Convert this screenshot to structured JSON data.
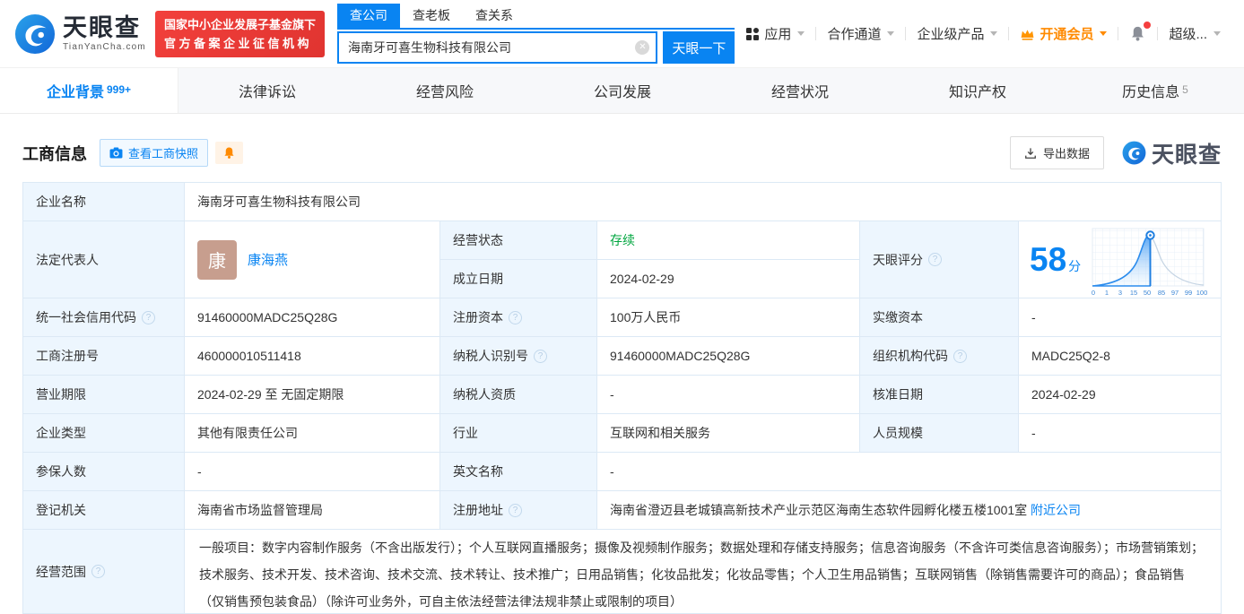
{
  "colors": {
    "brand_blue": "#0984f2",
    "badge_red": "#ee3c38",
    "vip_orange": "#ff8a00",
    "status_green": "#00a63f",
    "label_cell_bg": "#edf6fe"
  },
  "header": {
    "logo": {
      "name": "天眼查",
      "domain": "TianYanCha.com"
    },
    "badge": {
      "line1": "国家中小企业发展子基金旗下",
      "line2": "官方备案企业征信机构"
    },
    "search": {
      "tabs": [
        {
          "label": "查公司"
        },
        {
          "label": "查老板"
        },
        {
          "label": "查关系"
        }
      ],
      "value": "海南牙可喜生物科技有限公司",
      "button": "天眼一下"
    },
    "nav": [
      {
        "label": "应用"
      },
      {
        "label": "合作通道"
      },
      {
        "label": "企业级产品"
      },
      {
        "label": "开通会员"
      },
      {
        "label": "超级..."
      }
    ]
  },
  "tabs": [
    {
      "label": "企业背景",
      "badge": "999+"
    },
    {
      "label": "法律诉讼"
    },
    {
      "label": "经营风险"
    },
    {
      "label": "公司发展"
    },
    {
      "label": "经营状况"
    },
    {
      "label": "知识产权"
    },
    {
      "label": "历史信息",
      "badge": "5"
    }
  ],
  "section": {
    "title": "工商信息",
    "snapshot_button": "查看工商快照",
    "export_button": "导出数据",
    "logo_text": "天眼查"
  },
  "table": {
    "company_name": {
      "label": "企业名称",
      "value": "海南牙可喜生物科技有限公司"
    },
    "legal_rep": {
      "label": "法定代表人",
      "avatar": "康",
      "name": "康海燕"
    },
    "status": {
      "label": "经营状态",
      "value": "存续"
    },
    "established": {
      "label": "成立日期",
      "value": "2024-02-29"
    },
    "score": {
      "label": "天眼评分",
      "value": "58",
      "unit": "分"
    },
    "credit_code": {
      "label": "统一社会信用代码",
      "value": "91460000MADC25Q28G"
    },
    "reg_capital": {
      "label": "注册资本",
      "value": "100万人民币"
    },
    "paid_capital": {
      "label": "实缴资本",
      "value": "-"
    },
    "reg_number": {
      "label": "工商注册号",
      "value": "460000010511418"
    },
    "taxpayer_id": {
      "label": "纳税人识别号",
      "value": "91460000MADC25Q28G"
    },
    "org_code": {
      "label": "组织机构代码",
      "value": "MADC25Q2-8"
    },
    "business_term": {
      "label": "营业期限",
      "value": "2024-02-29 至 无固定期限"
    },
    "taxpayer_quality": {
      "label": "纳税人资质",
      "value": "-"
    },
    "approval_date": {
      "label": "核准日期",
      "value": "2024-02-29"
    },
    "company_type": {
      "label": "企业类型",
      "value": "其他有限责任公司"
    },
    "industry": {
      "label": "行业",
      "value": "互联网和相关服务"
    },
    "staff_size": {
      "label": "人员规模",
      "value": "-"
    },
    "insured_count": {
      "label": "参保人数",
      "value": "-"
    },
    "english_name": {
      "label": "英文名称",
      "value": "-"
    },
    "registry": {
      "label": "登记机关",
      "value": "海南省市场监督管理局"
    },
    "address": {
      "label": "注册地址",
      "value": "海南省澄迈县老城镇高新技术产业示范区海南生态软件园孵化楼五楼1001室",
      "nearby_link": "附近公司"
    },
    "business_scope": {
      "label": "经营范围",
      "value": "一般项目：数字内容制作服务（不含出版发行）；个人互联网直播服务；摄像及视频制作服务；数据处理和存储支持服务；信息咨询服务（不含许可类信息咨询服务）；市场营销策划；技术服务、技术开发、技术咨询、技术交流、技术转让、技术推广；日用品销售；化妆品批发；化妆品零售；个人卫生用品销售；互联网销售（除销售需要许可的商品）；食品销售（仅销售预包装食品）（除许可业务外，可自主依法经营法律法规非禁止或限制的项目）"
    }
  },
  "chart_data": {
    "type": "area",
    "title": "天眼评分",
    "score": 58,
    "unit": "分",
    "ticks": [
      0,
      1,
      3,
      15,
      50,
      85,
      97,
      99,
      100
    ],
    "xlim": [
      0,
      100
    ],
    "grid": true,
    "marker_at": 58
  }
}
